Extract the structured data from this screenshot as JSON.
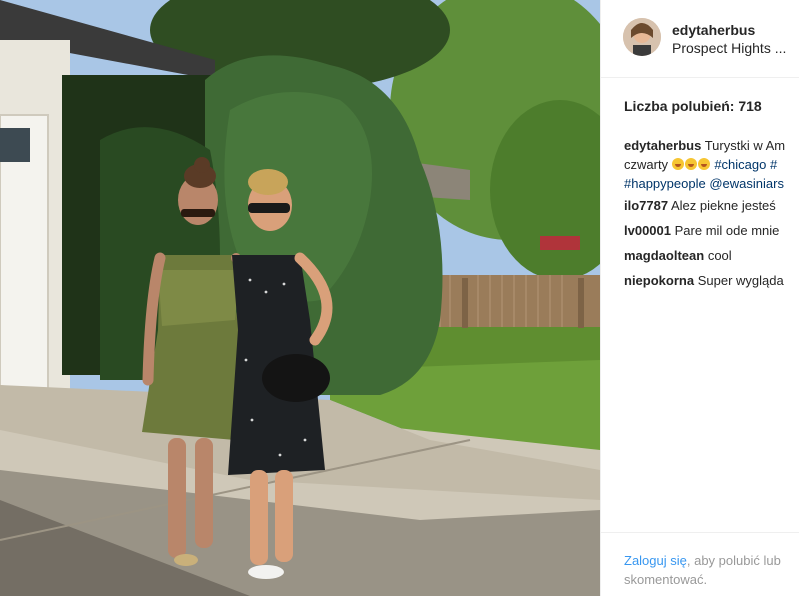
{
  "post": {
    "username": "edytaherbus",
    "location": "Prospect Hights ...",
    "likes_text": "Liczba polubień: 718"
  },
  "caption": {
    "username": "edytaherbus",
    "line1_text": "Turystki w Am",
    "line2_prefix": "czwarty",
    "emoji_names": [
      "face-with-tongue-emoji",
      "face-with-tongue-emoji",
      "face-with-tongue-emoji"
    ],
    "tag1": "#chicago",
    "tag2": "#",
    "tag3": "#happypeople",
    "mention": "@ewasiniars"
  },
  "comments": [
    {
      "username": "ilo7787",
      "text": "Alez piekne jesteś"
    },
    {
      "username": "lv00001",
      "text": "Pare mil ode mnie"
    },
    {
      "username": "magdaoltean",
      "text": "cool"
    },
    {
      "username": "niepokorna",
      "text": "Super wygląda"
    }
  ],
  "footer": {
    "login_link": "Zaloguj się",
    "login_rest": ", aby polubić lub",
    "line2": "skomentować."
  },
  "colors": {
    "link": "#3897f0",
    "hashtag": "#003569",
    "text": "#262626",
    "muted": "#999999"
  }
}
